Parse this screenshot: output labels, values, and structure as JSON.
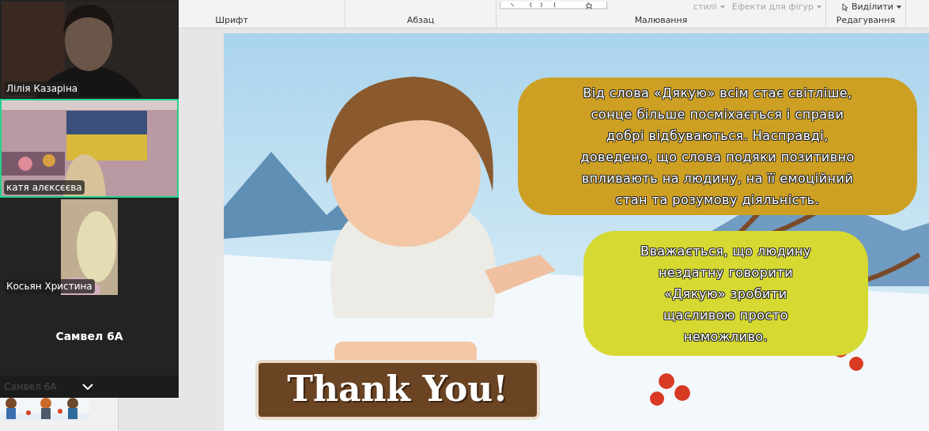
{
  "ribbon": {
    "groups": [
      {
        "label": "Шрифт"
      },
      {
        "label": "Абзац"
      },
      {
        "label": "Малювання",
        "items": [
          {
            "label": "стилі",
            "disabled": true
          },
          {
            "label": "Ефекти для фігур",
            "disabled": true
          }
        ]
      },
      {
        "label": "Редагування",
        "items": [
          {
            "label": "Виділити",
            "disabled": false
          }
        ]
      }
    ]
  },
  "slide": {
    "sign": "Thank You!",
    "bubbles": [
      {
        "text": "Від слова «Дякую» всім стає світліше,\nсонце більше посміхається і справи\nдобрі відбуваються. Насправді,\nдоведено, що слова подяки позитивно\nвпливають на людину, на її емоційний\nстан та розумову діяльність.",
        "color": "#cda023"
      },
      {
        "text": "Вважається, що людину\nнездатну говорити\n«Дякую» зробити\nщасливою просто\nнеможливо.",
        "color": "#d5d932"
      }
    ]
  },
  "video_panel": {
    "tiles": [
      {
        "name": "Лілія Казаріна",
        "kind": "video",
        "selected": false
      },
      {
        "name": "катя алєксєєва",
        "kind": "video",
        "selected": true
      },
      {
        "name": "Косьян Христина",
        "kind": "narrow-video",
        "selected": false
      },
      {
        "name": "Самвел 6А",
        "kind": "no-video",
        "selected": false
      }
    ],
    "footer_name": "Самвел 6А"
  }
}
